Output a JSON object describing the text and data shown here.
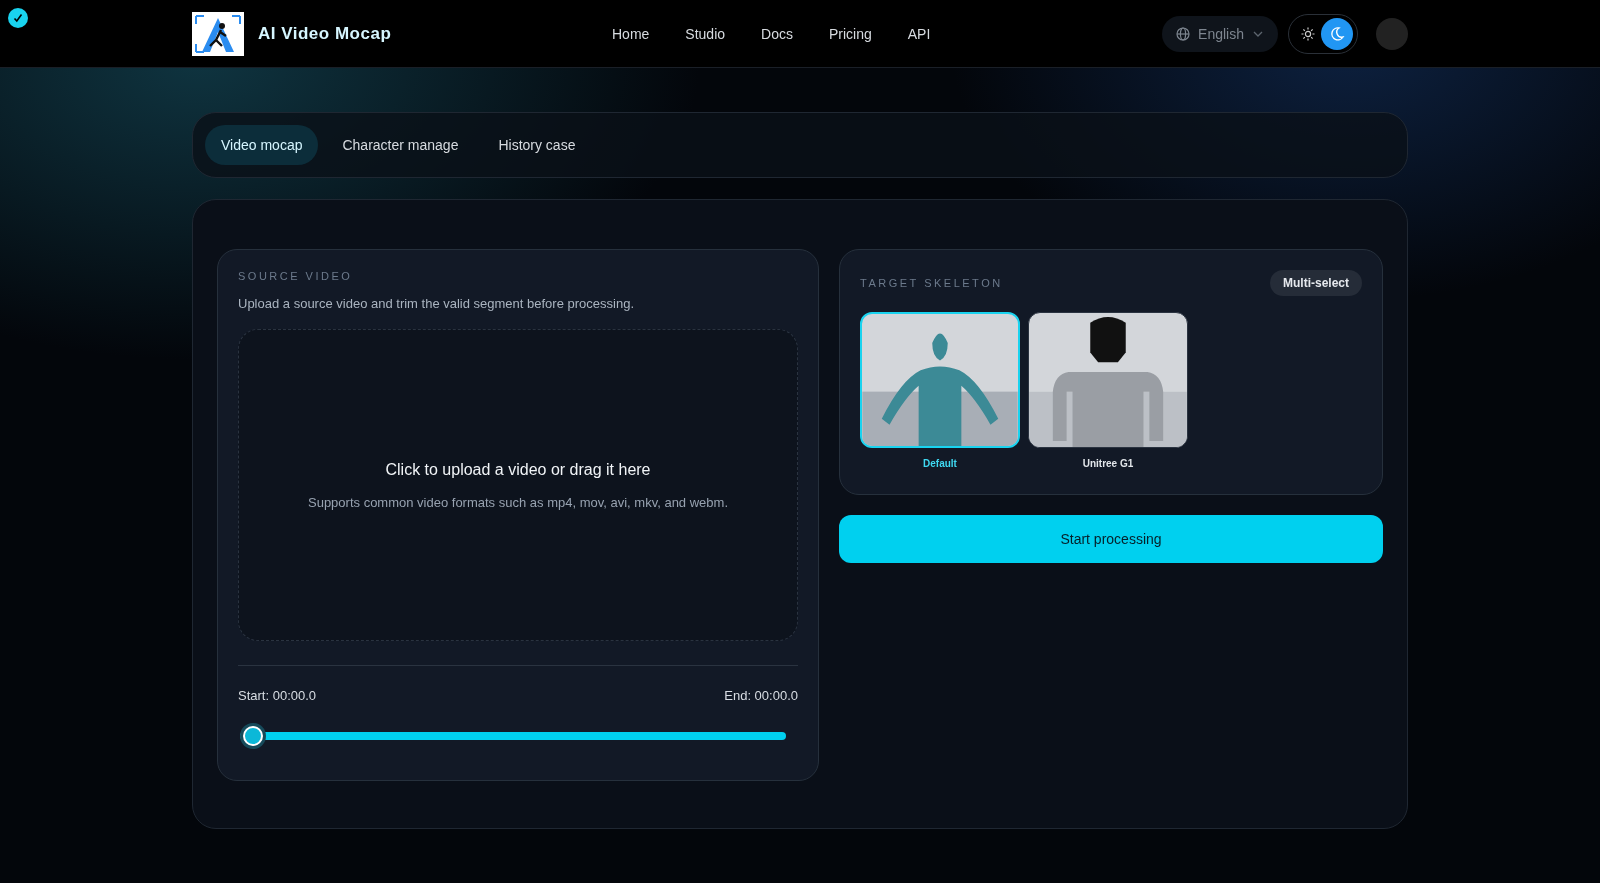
{
  "header": {
    "brand": "AI Video Mocap",
    "nav": [
      {
        "label": "Home"
      },
      {
        "label": "Studio"
      },
      {
        "label": "Docs"
      },
      {
        "label": "Pricing"
      },
      {
        "label": "API"
      }
    ],
    "language": "English",
    "theme": {
      "dark": true
    }
  },
  "tabs": [
    {
      "label": "Video mocap",
      "selected": true
    },
    {
      "label": "Character manage",
      "selected": false
    },
    {
      "label": "History case",
      "selected": false
    }
  ],
  "source": {
    "title": "SOURCE VIDEO",
    "description": "Upload a source video and trim the valid segment before processing.",
    "upload_title": "Click to upload a video or drag it here",
    "upload_hint": "Supports common video formats such as mp4, mov, avi, mkv, and webm.",
    "start": "Start: 00:00.0",
    "end": "End: 00:00.0",
    "trim": {
      "start": {
        "level": 0
      },
      "end": {
        "level": 1
      }
    }
  },
  "target": {
    "title": "TARGET SKELETON",
    "badge": "Multi-select",
    "skeletons": [
      {
        "name": "Default",
        "selected": true,
        "kind": "human"
      },
      {
        "name": "Unitree G1",
        "selected": false,
        "kind": "robot"
      }
    ]
  },
  "action": "Start processing"
}
